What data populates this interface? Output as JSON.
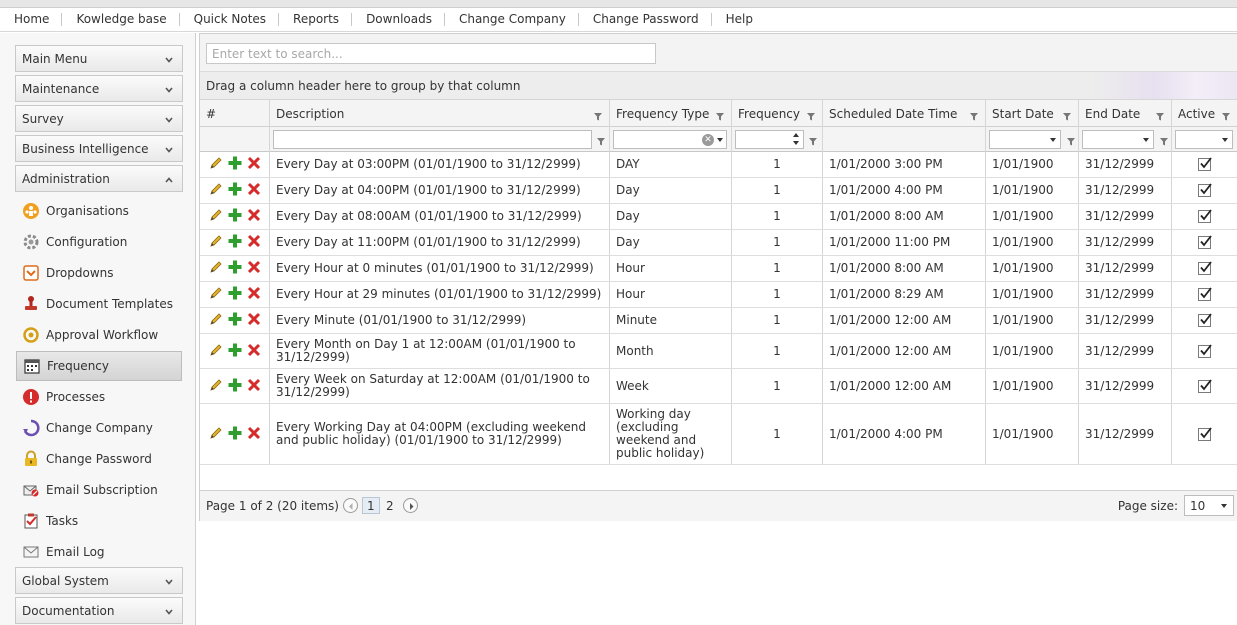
{
  "topnav": [
    "Home",
    "Kowledge base",
    "Quick Notes",
    "Reports",
    "Downloads",
    "Change Company",
    "Change Password",
    "Help"
  ],
  "sidebar": {
    "headers_top": [
      "Main Menu",
      "Maintenance",
      "Survey",
      "Business Intelligence",
      "Administration"
    ],
    "items": [
      {
        "label": "Organisations",
        "icon": "organisations-icon"
      },
      {
        "label": "Configuration",
        "icon": "gear-icon"
      },
      {
        "label": "Dropdowns",
        "icon": "dropdown-icon"
      },
      {
        "label": "Document Templates",
        "icon": "stamp-icon"
      },
      {
        "label": "Approval Workflow",
        "icon": "workflow-icon"
      },
      {
        "label": "Frequency",
        "icon": "calendar-icon"
      },
      {
        "label": "Processes",
        "icon": "exclamation-icon"
      },
      {
        "label": "Change Company",
        "icon": "change-company-icon"
      },
      {
        "label": "Change Password",
        "icon": "lock-icon"
      },
      {
        "label": "Email Subscription",
        "icon": "email-subscription-icon"
      },
      {
        "label": "Tasks",
        "icon": "tasks-icon"
      },
      {
        "label": "Email Log",
        "icon": "envelope-icon"
      }
    ],
    "headers_bottom": [
      "Global System",
      "Documentation"
    ],
    "selected": "Frequency"
  },
  "grid": {
    "search_placeholder": "Enter text to search...",
    "group_panel": "Drag a column header here to group by that column",
    "columns": [
      "#",
      "Description",
      "Frequency Type",
      "Frequency",
      "Scheduled Date Time",
      "Start Date",
      "End Date",
      "Active"
    ],
    "rows": [
      {
        "description": "Every Day at 03:00PM (01/01/1900 to 31/12/2999)",
        "type": "DAY",
        "frequency": "1",
        "scheduled": "1/01/2000 3:00 PM",
        "start": "1/01/1900",
        "end": "31/12/2999",
        "active": true
      },
      {
        "description": "Every Day at 04:00PM (01/01/1900 to 31/12/2999)",
        "type": "Day",
        "frequency": "1",
        "scheduled": "1/01/2000 4:00 PM",
        "start": "1/01/1900",
        "end": "31/12/2999",
        "active": true
      },
      {
        "description": "Every Day at 08:00AM (01/01/1900 to 31/12/2999)",
        "type": "Day",
        "frequency": "1",
        "scheduled": "1/01/2000 8:00 AM",
        "start": "1/01/1900",
        "end": "31/12/2999",
        "active": true
      },
      {
        "description": "Every Day at 11:00PM (01/01/1900 to 31/12/2999)",
        "type": "Day",
        "frequency": "1",
        "scheduled": "1/01/2000 11:00 PM",
        "start": "1/01/1900",
        "end": "31/12/2999",
        "active": true
      },
      {
        "description": "Every Hour at 0 minutes (01/01/1900 to 31/12/2999)",
        "type": "Hour",
        "frequency": "1",
        "scheduled": "1/01/2000 8:00 AM",
        "start": "1/01/1900",
        "end": "31/12/2999",
        "active": true
      },
      {
        "description": "Every Hour at 29 minutes (01/01/1900 to 31/12/2999)",
        "type": "Hour",
        "frequency": "1",
        "scheduled": "1/01/2000 8:29 AM",
        "start": "1/01/1900",
        "end": "31/12/2999",
        "active": true
      },
      {
        "description": "Every Minute (01/01/1900 to 31/12/2999)",
        "type": "Minute",
        "frequency": "1",
        "scheduled": "1/01/2000 12:00 AM",
        "start": "1/01/1900",
        "end": "31/12/2999",
        "active": true
      },
      {
        "description": "Every Month on Day 1 at 12:00AM (01/01/1900 to 31/12/2999)",
        "type": "Month",
        "frequency": "1",
        "scheduled": "1/01/2000 12:00 AM",
        "start": "1/01/1900",
        "end": "31/12/2999",
        "active": true
      },
      {
        "description": "Every Week on Saturday at 12:00AM (01/01/1900 to 31/12/2999)",
        "type": "Week",
        "frequency": "1",
        "scheduled": "1/01/2000 12:00 AM",
        "start": "1/01/1900",
        "end": "31/12/2999",
        "active": true
      },
      {
        "description": "Every Working Day at 04:00PM (excluding weekend and public holiday) (01/01/1900 to 31/12/2999)",
        "type": "Working day (excluding weekend and public holiday)",
        "frequency": "1",
        "scheduled": "1/01/2000 4:00 PM",
        "start": "1/01/1900",
        "end": "31/12/2999",
        "active": true
      }
    ],
    "footer": {
      "summary": "Page 1 of 2 (20 items)",
      "pages": [
        "1",
        "2"
      ],
      "current_page": "1",
      "page_size_label": "Page size:",
      "page_size": "10"
    }
  },
  "colors": {
    "edit": "#d9a21f",
    "add": "#2e9e2e",
    "delete": "#d62b2b",
    "accent": "#6d4fb0"
  }
}
